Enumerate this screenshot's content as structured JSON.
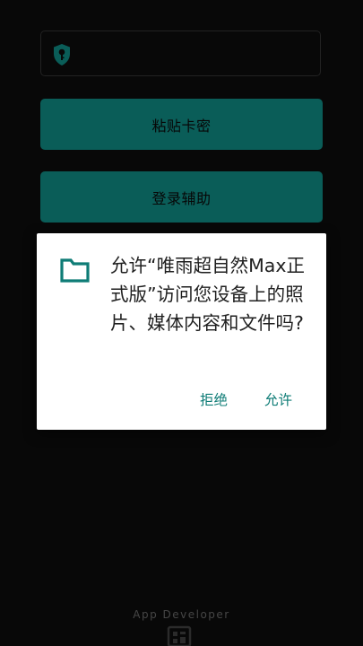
{
  "buttons": {
    "paste_key": "粘贴卡密",
    "login_helper": "登录辅助"
  },
  "dialog": {
    "message": "允许“唯雨超自然Max正式版”访问您设备上的照片、媒体内容和文件吗?",
    "deny": "拒绝",
    "allow": "允许"
  },
  "footer": {
    "text": "App Developer"
  },
  "colors": {
    "accent": "#0e7c76",
    "background": "#0b0b0b",
    "dialog": "#ffffff"
  },
  "icons": {
    "key_field": "shield-key-icon",
    "dialog": "folder-icon",
    "footer": "app-grid-icon"
  }
}
